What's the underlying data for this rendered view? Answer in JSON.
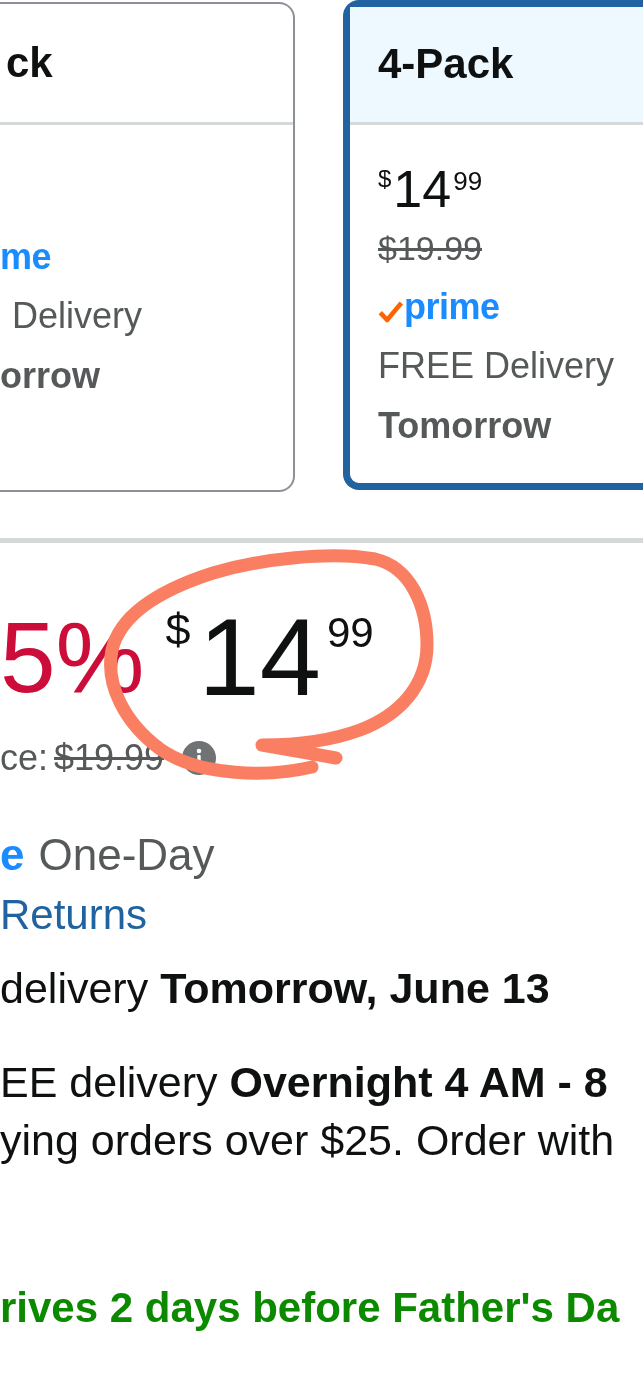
{
  "options": [
    {
      "title": "ck",
      "selected": false,
      "prime_check": false,
      "prime": "me",
      "delivery": "Delivery",
      "date": "orrow"
    },
    {
      "title": "4-Pack",
      "selected": true,
      "price": {
        "symbol": "$",
        "whole": "14",
        "fraction": "99"
      },
      "list_price": "$19.99",
      "prime_check": true,
      "prime": "prime",
      "delivery": "FREE Delivery",
      "date": "Tomorrow"
    }
  ],
  "buybox": {
    "discount": "5%",
    "price": {
      "symbol": "$",
      "whole": "14",
      "fraction": "99"
    },
    "list_price_label": "ce:",
    "list_price": "$19.99",
    "prime_check": false,
    "prime": "e",
    "prime_service": "One-Day",
    "returns_link": "Returns",
    "primary_delivery": "delivery **Tomorrow, June 13**",
    "secondary_delivery": [
      "EE delivery **Overnight 4 AM - 8**",
      "ying orders over $25. Order with"
    ],
    "promo": "rives 2 days before Father's Da"
  }
}
